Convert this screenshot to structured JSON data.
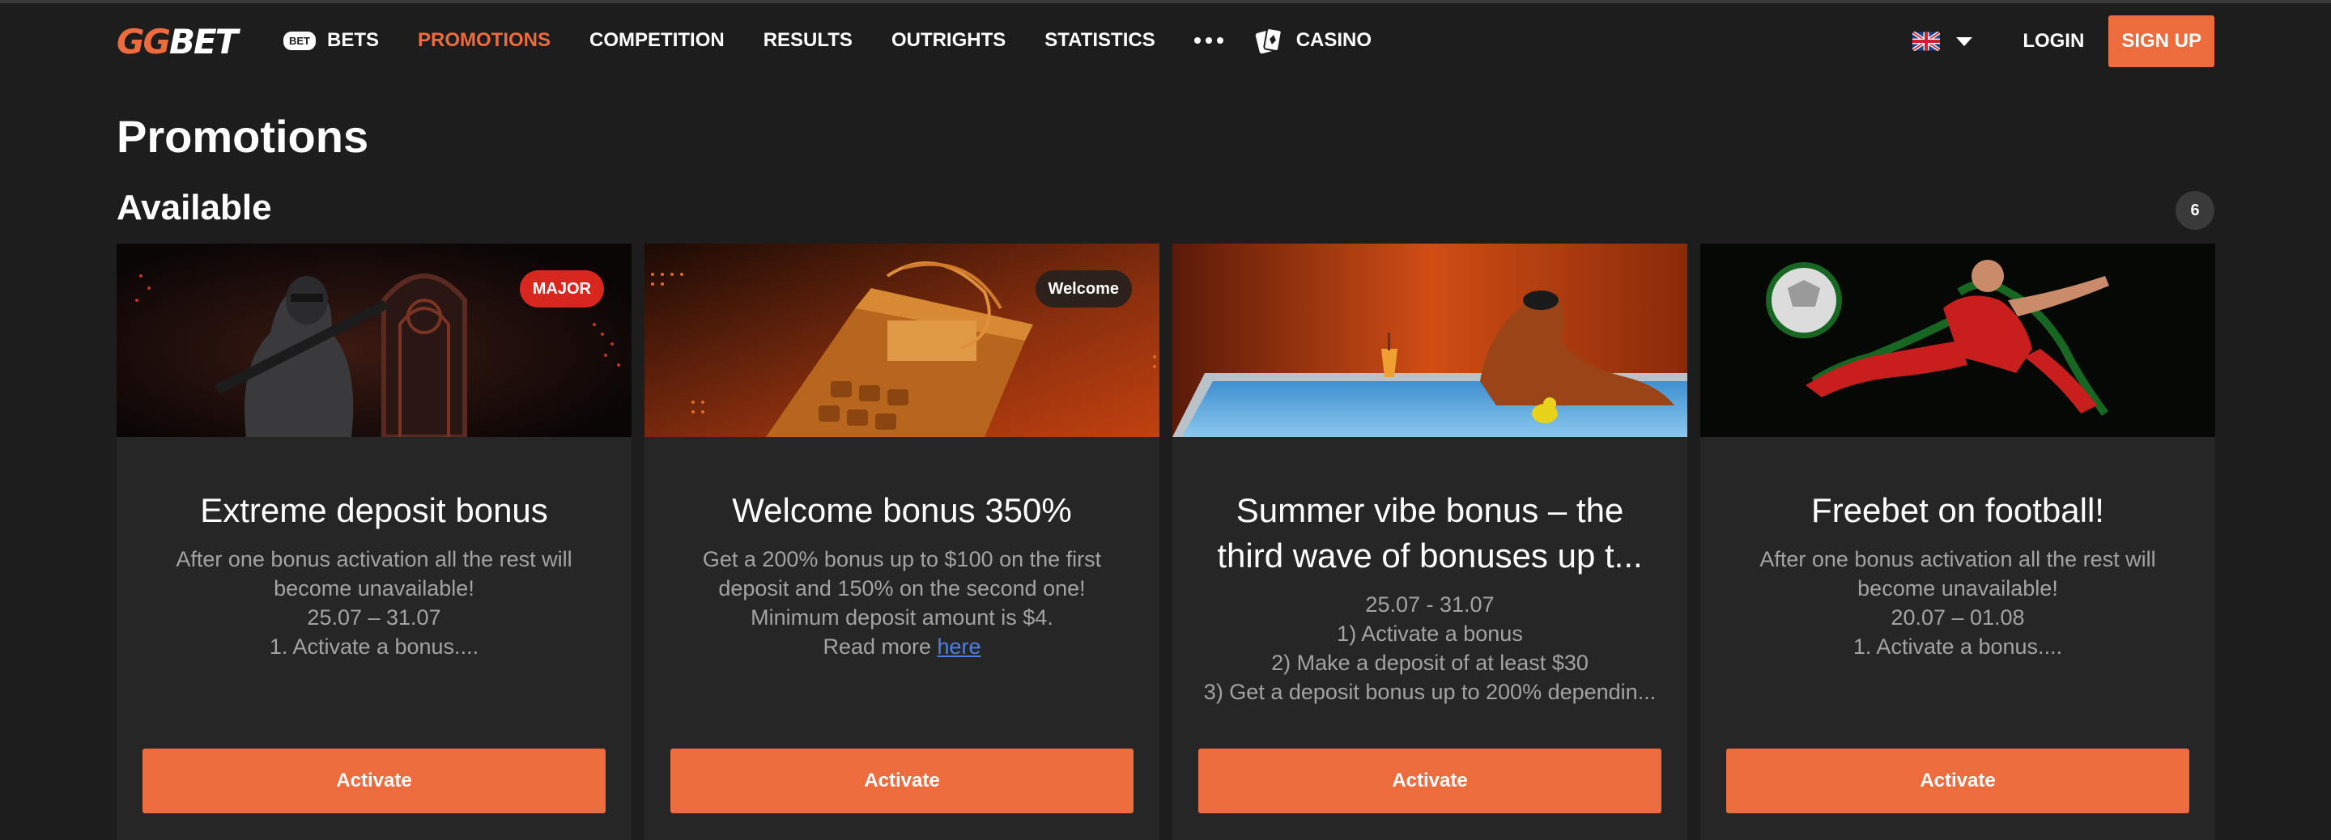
{
  "header": {
    "logo_text_gg": "GG",
    "logo_text_bet": "BET",
    "bets_badge": "BET",
    "nav": [
      {
        "label": "BETS",
        "active": false
      },
      {
        "label": "PROMOTIONS",
        "active": true
      },
      {
        "label": "COMPETITION",
        "active": false
      },
      {
        "label": "RESULTS",
        "active": false
      },
      {
        "label": "OUTRIGHTS",
        "active": false
      },
      {
        "label": "STATISTICS",
        "active": false
      },
      {
        "label": "CASINO",
        "active": false
      }
    ],
    "login_label": "LOGIN",
    "signup_label": "SIGN UP",
    "language_icon": "uk-flag-icon"
  },
  "page": {
    "title": "Promotions",
    "section_title": "Available",
    "section_count": "6"
  },
  "cards": [
    {
      "tag": "MAJOR",
      "title": "Extreme deposit bonus",
      "lines": [
        "After one bonus activation all the rest will",
        "become unavailable!",
        "25.07 – 31.07",
        "1. Activate a bonus...."
      ],
      "button": "Activate"
    },
    {
      "tag": "Welcome",
      "title": "Welcome bonus 350%",
      "lines": [
        "Get a 200% bonus up to $100 on the first",
        "deposit and 150% on the second one!",
        "Minimum deposit amount is $4."
      ],
      "read_more_prefix": "Read more ",
      "read_more_link": "here",
      "button": "Activate"
    },
    {
      "title_line1": "Summer vibe bonus – the",
      "title_line2": "third wave of bonuses up t...",
      "lines": [
        "25.07 - 31.07",
        "1) Activate a bonus",
        "2) Make a deposit of at least $30",
        "3) Get a deposit bonus up to 200% dependin..."
      ],
      "button": "Activate"
    },
    {
      "title": "Freebet on football!",
      "lines": [
        "After one bonus activation all the rest will",
        "become unavailable!",
        "20.07 – 01.08",
        "1. Activate a bonus...."
      ],
      "button": "Activate"
    }
  ],
  "colors": {
    "background": "#1d1d1d",
    "card": "#262626",
    "accent": "#ed6c3d",
    "major_tag": "#d8271f",
    "muted_text": "#a3a3a3",
    "link": "#4f7fe0"
  }
}
